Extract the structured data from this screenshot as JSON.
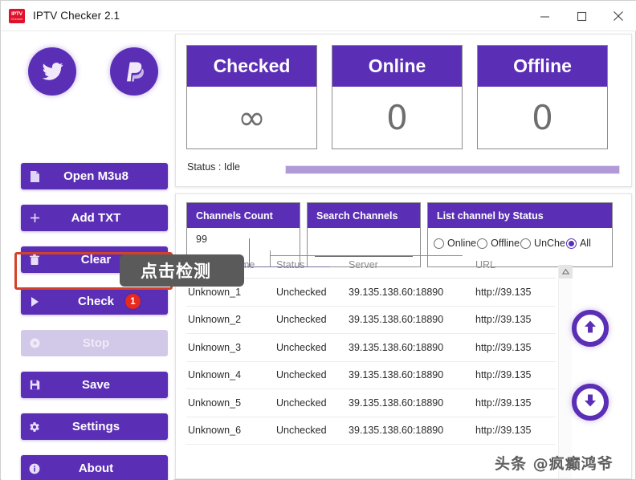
{
  "window": {
    "title": "IPTV Checker 2.1",
    "icon_line1": "IPTV",
    "icon_line2": "Checker",
    "controls": {
      "minimize": "minimize-icon",
      "maximize": "maximize-icon",
      "close": "close-icon"
    }
  },
  "sidebar": {
    "social": [
      {
        "name": "twitter",
        "icon": "twitter-icon"
      },
      {
        "name": "paypal",
        "icon": "paypal-icon"
      }
    ],
    "buttons": [
      {
        "label": "Open M3u8",
        "icon": "file-icon",
        "disabled": false,
        "badge": null
      },
      {
        "label": "Add TXT",
        "icon": "plus-icon",
        "disabled": false,
        "badge": null
      },
      {
        "label": "Clear",
        "icon": "trash-icon",
        "disabled": false,
        "badge": null
      },
      {
        "label": "Check",
        "icon": "play-icon",
        "disabled": false,
        "badge": "1"
      },
      {
        "label": "Stop",
        "icon": "stop-icon",
        "disabled": true,
        "badge": null
      },
      {
        "label": "Save",
        "icon": "save-icon",
        "disabled": false,
        "badge": null
      },
      {
        "label": "Settings",
        "icon": "gear-icon",
        "disabled": false,
        "badge": null
      },
      {
        "label": "About",
        "icon": "info-icon",
        "disabled": false,
        "badge": null
      }
    ]
  },
  "annotation": {
    "tooltip_text": "点击检测",
    "highlight_color": "#d4412a"
  },
  "stats": [
    {
      "title": "Checked",
      "value": "∞"
    },
    {
      "title": "Online",
      "value": "0"
    },
    {
      "title": "Offline",
      "value": "0"
    }
  ],
  "status": {
    "label": "Status : Idle",
    "progress_percent": 100
  },
  "filters": {
    "channels_count": {
      "title": "Channels Count",
      "value": "99"
    },
    "search": {
      "title": "Search Channels",
      "value": "",
      "placeholder": ""
    },
    "list_by_status": {
      "title": "List channel by Status",
      "options": [
        {
          "label": "Online",
          "selected": false
        },
        {
          "label": "Offline",
          "selected": false
        },
        {
          "label": "UnChe",
          "selected": false
        },
        {
          "label": "All",
          "selected": true
        }
      ]
    }
  },
  "table": {
    "columns": [
      "Channel Name",
      "Status",
      "Server",
      "URL"
    ],
    "rows": [
      {
        "name": "Unknown_1",
        "status": "Unchecked",
        "server": "39.135.138.60:18890",
        "url": "http://39.135"
      },
      {
        "name": "Unknown_2",
        "status": "Unchecked",
        "server": "39.135.138.60:18890",
        "url": "http://39.135"
      },
      {
        "name": "Unknown_3",
        "status": "Unchecked",
        "server": "39.135.138.60:18890",
        "url": "http://39.135"
      },
      {
        "name": "Unknown_4",
        "status": "Unchecked",
        "server": "39.135.138.60:18890",
        "url": "http://39.135"
      },
      {
        "name": "Unknown_5",
        "status": "Unchecked",
        "server": "39.135.138.60:18890",
        "url": "http://39.135"
      },
      {
        "name": "Unknown_6",
        "status": "Unchecked",
        "server": "39.135.138.60:18890",
        "url": "http://39.135"
      }
    ]
  },
  "nav": {
    "move_up": "arrow-up-icon",
    "move_down": "arrow-down-icon"
  },
  "watermark": {
    "text": "头条 @疯癫鸿爷"
  },
  "colors": {
    "accent_purple": "#5b2fb5",
    "badge_red": "#e8291e",
    "progress_fill": "#b19ad8",
    "disabled": "#d2c8e8",
    "annotation": "#d4412a"
  }
}
